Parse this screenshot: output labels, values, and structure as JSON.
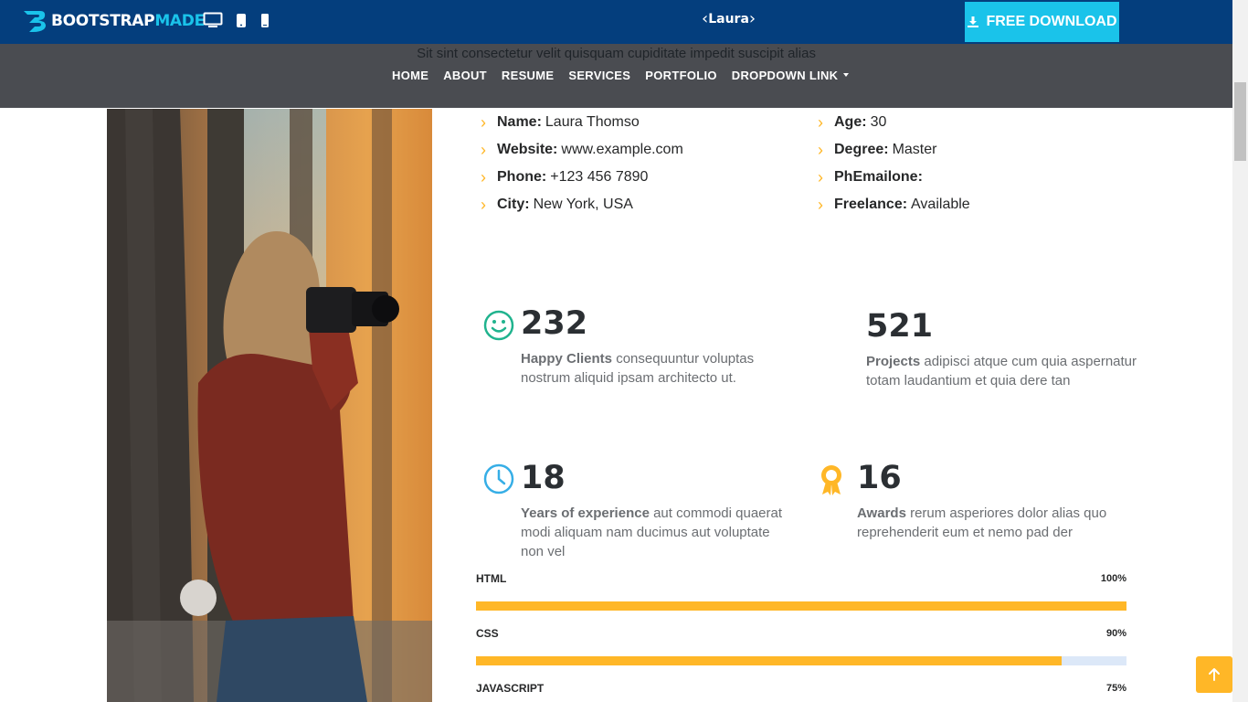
{
  "topbar": {
    "brand_main": "BOOTSTRAP",
    "brand_accent": "MADE",
    "devices": [
      "desktop-icon",
      "tablet-icon",
      "phone-icon"
    ],
    "theme_name": "Laura",
    "download_label": "FREE DOWNLOAD",
    "colors": {
      "bar": "#043e7d",
      "accent": "#1ac3ea"
    }
  },
  "header": {
    "subtitle": "Sit sint consectetur velit quisquam cupiditate impedit suscipit alias",
    "nav": [
      "HOME",
      "ABOUT",
      "RESUME",
      "SERVICES",
      "PORTFOLIO",
      "DROPDOWN LINK"
    ]
  },
  "info": {
    "left": [
      {
        "label": "Name:",
        "value": "Laura Thomso"
      },
      {
        "label": "Website:",
        "value": "www.example.com"
      },
      {
        "label": "Phone:",
        "value": "+123 456 7890"
      },
      {
        "label": "City:",
        "value": "New York, USA"
      }
    ],
    "right": [
      {
        "label": "Age:",
        "value": "30"
      },
      {
        "label": "Degree:",
        "value": "Master"
      },
      {
        "label": "PhEmailone:",
        "value": ""
      },
      {
        "label": "Freelance:",
        "value": "Available"
      }
    ]
  },
  "counters": [
    {
      "icon": "smile-icon",
      "number": "232",
      "title": "Happy Clients",
      "text": "consequuntur voluptas",
      "text2": "nostrum aliquid ipsam architecto ut."
    },
    {
      "icon": "",
      "number": "521",
      "title": "Projects",
      "text": "adipisci atque cum quia aspernatur",
      "text2": "totam laudantium et quia dere tan"
    },
    {
      "icon": "clock-icon",
      "number": "18",
      "title": "Years of experience",
      "text": "aut commodi quaerat",
      "text2": "modi aliquam nam ducimus aut voluptate",
      "text3": "non vel"
    },
    {
      "icon": "award-icon",
      "number": "16",
      "title": "Awards",
      "text": "rerum asperiores dolor alias quo",
      "text2": "reprehenderit eum et nemo pad der"
    }
  ],
  "skills": [
    {
      "name": "HTML",
      "percent_label": "100%",
      "percent": 100
    },
    {
      "name": "CSS",
      "percent_label": "90%",
      "percent": 90
    },
    {
      "name": "JAVASCRIPT",
      "percent_label": "75%",
      "percent": 75
    }
  ],
  "accent_color": "#ffb727"
}
